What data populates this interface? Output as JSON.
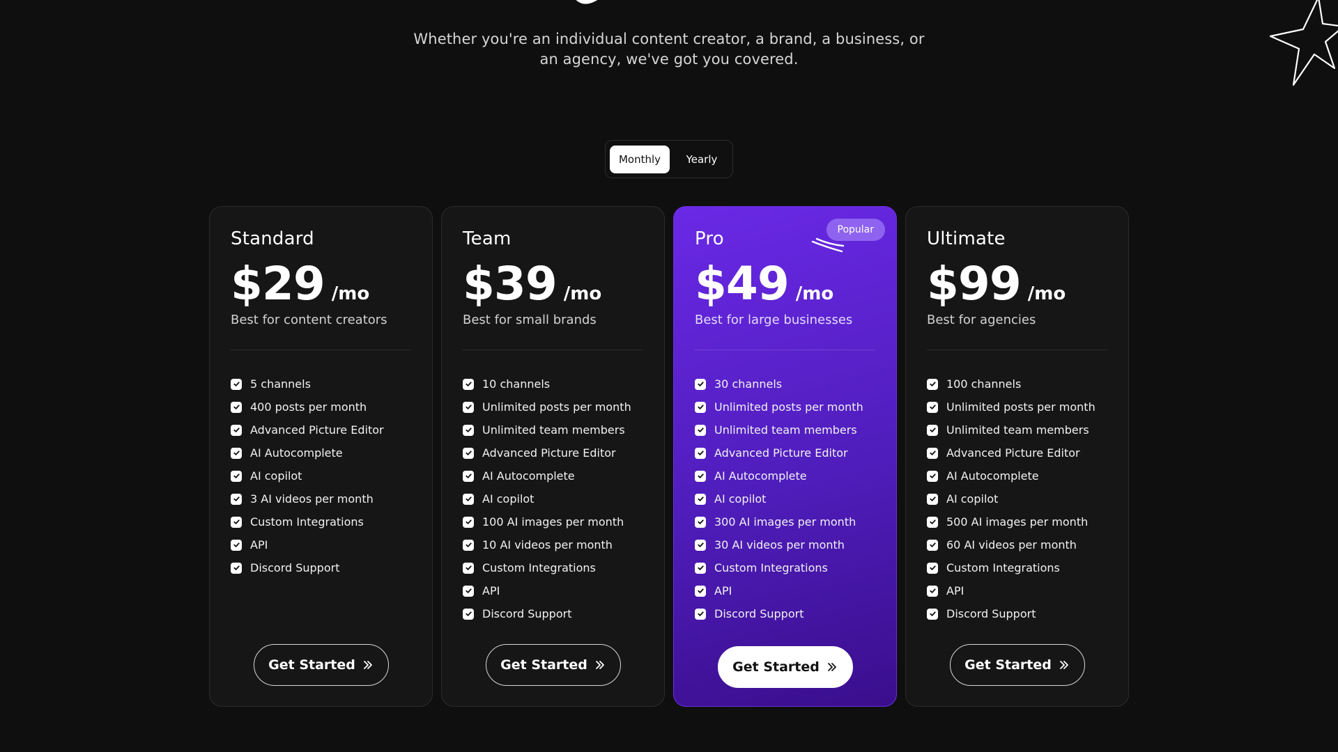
{
  "hero": {
    "subtitle_line1": "Whether you're an individual content creator, a brand, a business, or",
    "subtitle_line2": "an agency, we've got you covered."
  },
  "billing_toggle": {
    "options": [
      "Monthly",
      "Yearly"
    ],
    "selected": "Monthly"
  },
  "plans": [
    {
      "name": "Standard",
      "price": "$29",
      "period": "/mo",
      "description": "Best for content creators",
      "features": [
        "5 channels",
        "400 posts per month",
        "Advanced Picture Editor",
        "AI Autocomplete",
        "AI copilot",
        "3 AI videos per month",
        "Custom Integrations",
        "API",
        "Discord Support"
      ],
      "cta": "Get Started"
    },
    {
      "name": "Team",
      "price": "$39",
      "period": "/mo",
      "description": "Best for small brands",
      "features": [
        "10 channels",
        "Unlimited posts per month",
        "Unlimited team members",
        "Advanced Picture Editor",
        "AI Autocomplete",
        "AI copilot",
        "100 AI images per month",
        "10 AI videos per month",
        "Custom Integrations",
        "API",
        "Discord Support"
      ],
      "cta": "Get Started"
    },
    {
      "name": "Pro",
      "price": "$49",
      "period": "/mo",
      "description": "Best for large businesses",
      "badge": "Popular",
      "features": [
        "30 channels",
        "Unlimited posts per month",
        "Unlimited team members",
        "Advanced Picture Editor",
        "AI Autocomplete",
        "AI copilot",
        "300 AI images per month",
        "30 AI videos per month",
        "Custom Integrations",
        "API",
        "Discord Support"
      ],
      "cta": "Get Started"
    },
    {
      "name": "Ultimate",
      "price": "$99",
      "period": "/mo",
      "description": "Best for agencies",
      "features": [
        "100 channels",
        "Unlimited posts per month",
        "Unlimited team members",
        "Advanced Picture Editor",
        "AI Autocomplete",
        "AI copilot",
        "500 AI images per month",
        "60 AI videos per month",
        "Custom Integrations",
        "API",
        "Discord Support"
      ],
      "cta": "Get Started"
    }
  ],
  "colors": {
    "background": "#0f0f0f",
    "card": "#161616",
    "featured_gradient_start": "#6a29e6",
    "featured_gradient_end": "#3a0e8c",
    "badge": "#8e63ef"
  },
  "icons": {
    "check": "check-square-icon",
    "cta_arrow": "double-chevron-right-icon",
    "decoration": "star-outline-icon"
  }
}
